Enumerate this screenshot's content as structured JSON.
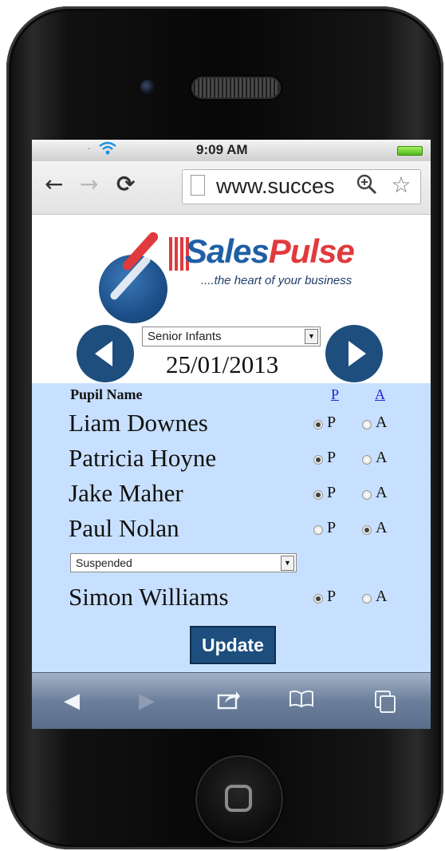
{
  "status_bar": {
    "time": "9:09 AM",
    "signal": "."
  },
  "browser": {
    "url": "www.succes"
  },
  "logo": {
    "brand_part1": "Sales",
    "brand_part2": "Pulse",
    "tagline": "....the heart of your business"
  },
  "class_selector": {
    "selected": "Senior Infants"
  },
  "date": "25/01/2013",
  "attendance": {
    "header": {
      "name": "Pupil Name",
      "present": "P",
      "absent": "A"
    },
    "pupils": [
      {
        "name": "Liam Downes",
        "status": "P",
        "present_label": "P",
        "absent_label": "A"
      },
      {
        "name": "Patricia Hoyne",
        "status": "P",
        "present_label": "P",
        "absent_label": "A"
      },
      {
        "name": "Jake Maher",
        "status": "P",
        "present_label": "P",
        "absent_label": "A"
      },
      {
        "name": "Paul Nolan",
        "status": "A",
        "present_label": "P",
        "absent_label": "A",
        "reason": "Suspended"
      },
      {
        "name": "Simon Williams",
        "status": "P",
        "present_label": "P",
        "absent_label": "A"
      }
    ]
  },
  "update_button": "Update",
  "colors": {
    "accent": "#1d4e7e",
    "panel": "#c8e0ff",
    "brand_blue": "#1f5fa5",
    "brand_red": "#e03a3e"
  }
}
